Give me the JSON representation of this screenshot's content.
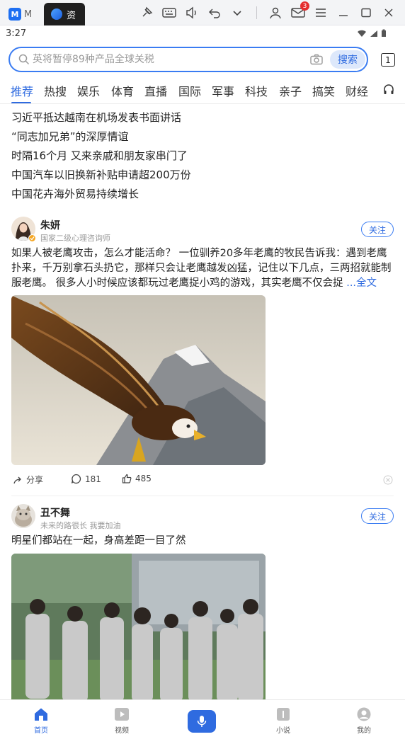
{
  "emulator": {
    "tab1_label": "M",
    "tab2_label": "资",
    "mail_badge": "3"
  },
  "status_bar": {
    "time": "3:27"
  },
  "search": {
    "placeholder": "英将暂停89种产品全球关税",
    "button_label": "搜索",
    "tab_count": "1"
  },
  "channels": [
    "推荐",
    "热搜",
    "娱乐",
    "体育",
    "直播",
    "国际",
    "军事",
    "科技",
    "亲子",
    "搞笑",
    "财经"
  ],
  "headlines": [
    "习近平抵达越南在机场发表书面讲话",
    "“同志加兄弟”的深厚情谊",
    "时隔16个月 又来亲戚和朋友家串门了",
    "中国汽车以旧换新补贴申请超200万份",
    "中国花卉海外贸易持续增长"
  ],
  "posts": [
    {
      "author": "朱妍",
      "author_desc": "国家二级心理咨询师",
      "follow_label": "关注",
      "text": "如果人被老鹰攻击，怎么才能活命？ 一位驯养20多年老鹰的牧民告诉我：遇到老鹰扑来，千万别拿石头扔它，那样只会让老鹰越发凶猛，记住以下几点，三两招就能制服老鹰。 很多人小时候应该都玩过老鹰捉小鸡的游戏，其实老鹰不仅会捉 ",
      "more_label": "...全文",
      "share_label": "分享",
      "comments": "181",
      "likes": "485"
    },
    {
      "author": "丑不舞",
      "author_desc": "未来的路很长  我要加油",
      "follow_label": "关注",
      "text": "明星们都站在一起，身高差距一目了然"
    }
  ],
  "bottom_nav": {
    "home": "首页",
    "video": "视频",
    "novel": "小说",
    "mine": "我的"
  },
  "colors": {
    "accent": "#2f6be0",
    "search_border": "#3a7cf2",
    "badge": "#e52e2e"
  }
}
